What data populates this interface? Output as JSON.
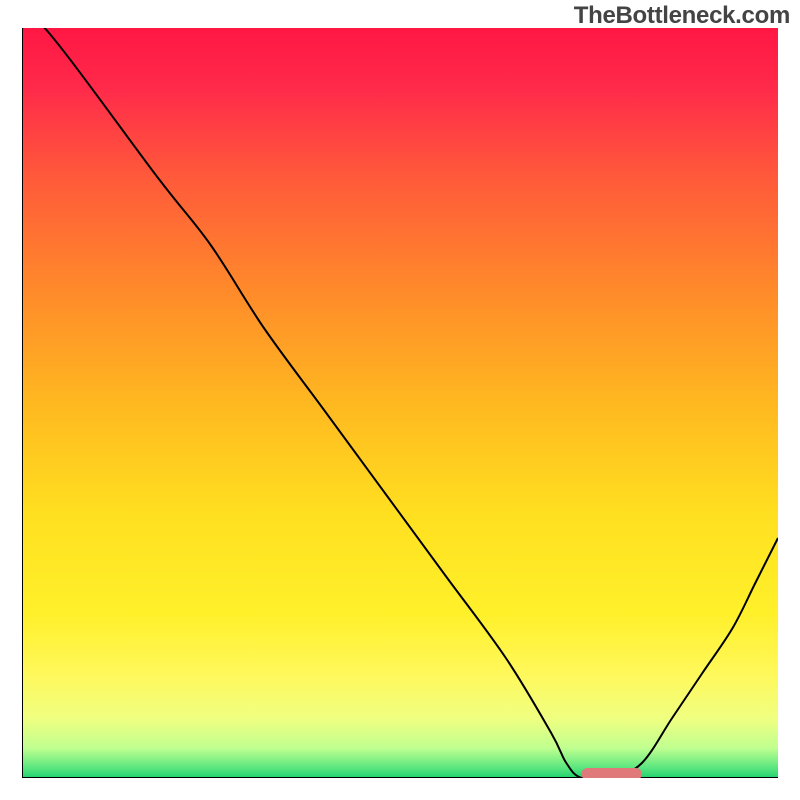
{
  "watermark": "TheBottleneck.com",
  "chart_data": {
    "type": "line",
    "title": "",
    "xlabel": "",
    "ylabel": "",
    "xlim": [
      0,
      100
    ],
    "ylim": [
      0,
      100
    ],
    "x": [
      0,
      3,
      18,
      25,
      32,
      40,
      48,
      56,
      64,
      70,
      72,
      74,
      78,
      82,
      86,
      90,
      94,
      97,
      100
    ],
    "values": [
      100,
      100,
      80,
      71,
      60,
      49,
      38,
      27,
      16,
      6,
      2,
      0,
      0,
      2,
      8,
      14,
      20,
      26,
      32
    ],
    "marker": {
      "x_start": 74,
      "x_end": 82,
      "y": 0
    },
    "gradient_stops": [
      {
        "offset": 0.0,
        "color": "#ff1744"
      },
      {
        "offset": 0.08,
        "color": "#ff2a4a"
      },
      {
        "offset": 0.2,
        "color": "#ff5a3a"
      },
      {
        "offset": 0.35,
        "color": "#ff8a2a"
      },
      {
        "offset": 0.5,
        "color": "#ffb820"
      },
      {
        "offset": 0.65,
        "color": "#ffe020"
      },
      {
        "offset": 0.78,
        "color": "#fff02a"
      },
      {
        "offset": 0.86,
        "color": "#fff85a"
      },
      {
        "offset": 0.92,
        "color": "#f0ff80"
      },
      {
        "offset": 0.96,
        "color": "#c0ff90"
      },
      {
        "offset": 0.985,
        "color": "#60e880"
      },
      {
        "offset": 1.0,
        "color": "#20d070"
      }
    ]
  }
}
